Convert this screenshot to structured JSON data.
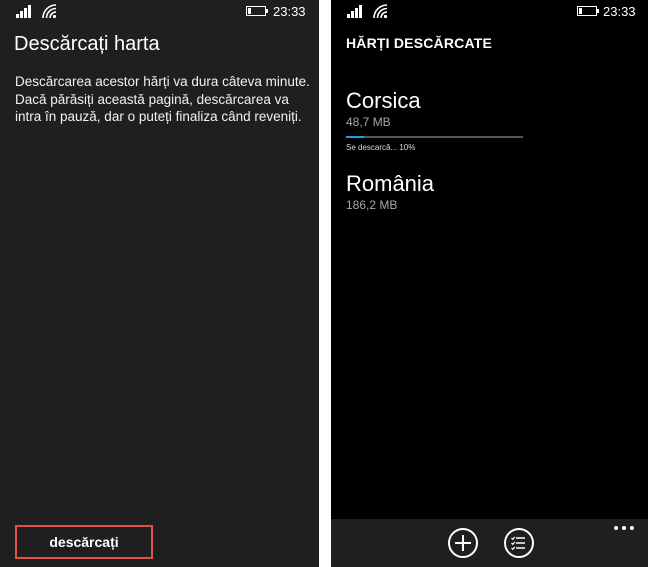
{
  "left_screen": {
    "status": {
      "time": "23:33"
    },
    "title": "Descărcați harta",
    "description": "Descărcarea acestor hărți va dura câteva minute. Dacă părăsiți această pagină, descărcarea va intra în pauză, dar o puteți finaliza când reveniți.",
    "download_button": "descărcați",
    "colors": {
      "background": "#1f1f1f",
      "highlight_border": "#e0524a"
    }
  },
  "right_screen": {
    "status": {
      "time": "23:33"
    },
    "header": "HĂRȚI DESCĂRCATE",
    "maps": [
      {
        "name": "Corsica",
        "size": "48,7 MB",
        "status": "Se descarcă... 10%",
        "progress": 0.1
      },
      {
        "name": "România",
        "size": "186,2 MB"
      }
    ],
    "app_bar": {
      "buttons": [
        "add-icon",
        "list-icon"
      ],
      "more": "ellipsis-icon"
    },
    "colors": {
      "background": "#000000",
      "accent": "#1ba1e2",
      "app_bar": "#1f1f1f"
    }
  }
}
